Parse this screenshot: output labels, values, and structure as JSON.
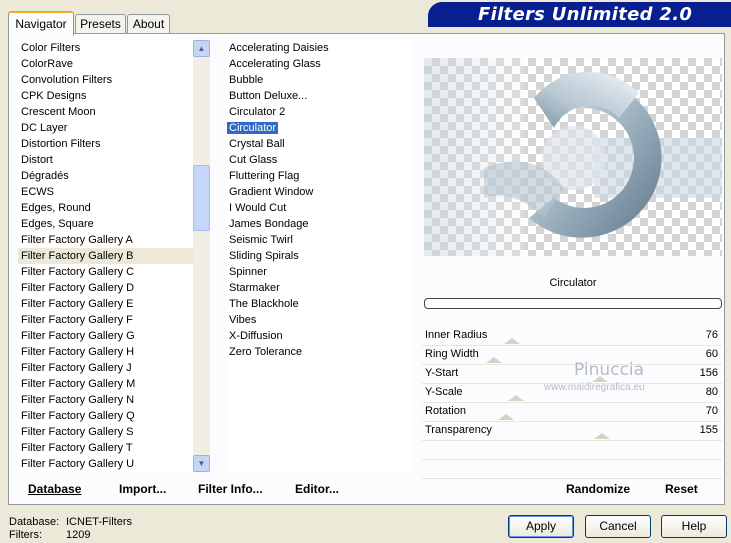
{
  "app_title": "Filters Unlimited 2.0",
  "tabs": [
    {
      "label": "Navigator",
      "active": true
    },
    {
      "label": "Presets",
      "active": false
    },
    {
      "label": "About",
      "active": false
    }
  ],
  "categories": [
    "Color Filters",
    "ColorRave",
    "Convolution Filters",
    "CPK Designs",
    "Crescent Moon",
    "DC Layer",
    "Distortion Filters",
    "Distort",
    "Dégradés",
    "ECWS",
    "Edges, Round",
    "Edges, Square",
    "Filter Factory Gallery A",
    "Filter Factory Gallery B",
    "Filter Factory Gallery C",
    "Filter Factory Gallery D",
    "Filter Factory Gallery E",
    "Filter Factory Gallery F",
    "Filter Factory Gallery G",
    "Filter Factory Gallery H",
    "Filter Factory Gallery J",
    "Filter Factory Gallery M",
    "Filter Factory Gallery N",
    "Filter Factory Gallery Q",
    "Filter Factory Gallery S",
    "Filter Factory Gallery T",
    "Filter Factory Gallery U"
  ],
  "selected_category": "Filter Factory Gallery B",
  "filters": [
    "Accelerating Daisies",
    "Accelerating Glass",
    "Bubble",
    "Button Deluxe...",
    "Circulator 2",
    "Circulator",
    "Crystal Ball",
    "Cut Glass",
    "Fluttering Flag",
    "Gradient Window",
    "I Would Cut",
    "James Bondage",
    "Seismic Twirl",
    "Sliding Spirals",
    "Spinner",
    "Starmaker",
    "The Blackhole",
    "Vibes",
    "X-Diffusion",
    "Zero Tolerance"
  ],
  "selected_filter": "Circulator",
  "filter_name": "Circulator",
  "params": [
    {
      "label": "Inner Radius",
      "value": "76"
    },
    {
      "label": "Ring Width",
      "value": "60"
    },
    {
      "label": "Y-Start",
      "value": "156"
    },
    {
      "label": "Y-Scale",
      "value": "80"
    },
    {
      "label": "Rotation",
      "value": "70"
    },
    {
      "label": "Transparency",
      "value": "155"
    }
  ],
  "watermark": {
    "name": "Pinuccia",
    "site": "www.maidiregrafica.eu"
  },
  "bottom_links": {
    "database": "Database",
    "import": "Import...",
    "filter_info": "Filter Info...",
    "editor": "Editor...",
    "randomize": "Randomize",
    "reset": "Reset"
  },
  "status": {
    "database_label": "Database:",
    "database_value": "ICNET-Filters",
    "filters_label": "Filters:",
    "filters_value": "1209"
  },
  "buttons": {
    "apply": "Apply",
    "cancel": "Cancel",
    "help": "Help"
  },
  "colors": {
    "banner": "#0a1f8f",
    "selection": "#316ac5",
    "active_tab_accent": "#f5a623"
  }
}
